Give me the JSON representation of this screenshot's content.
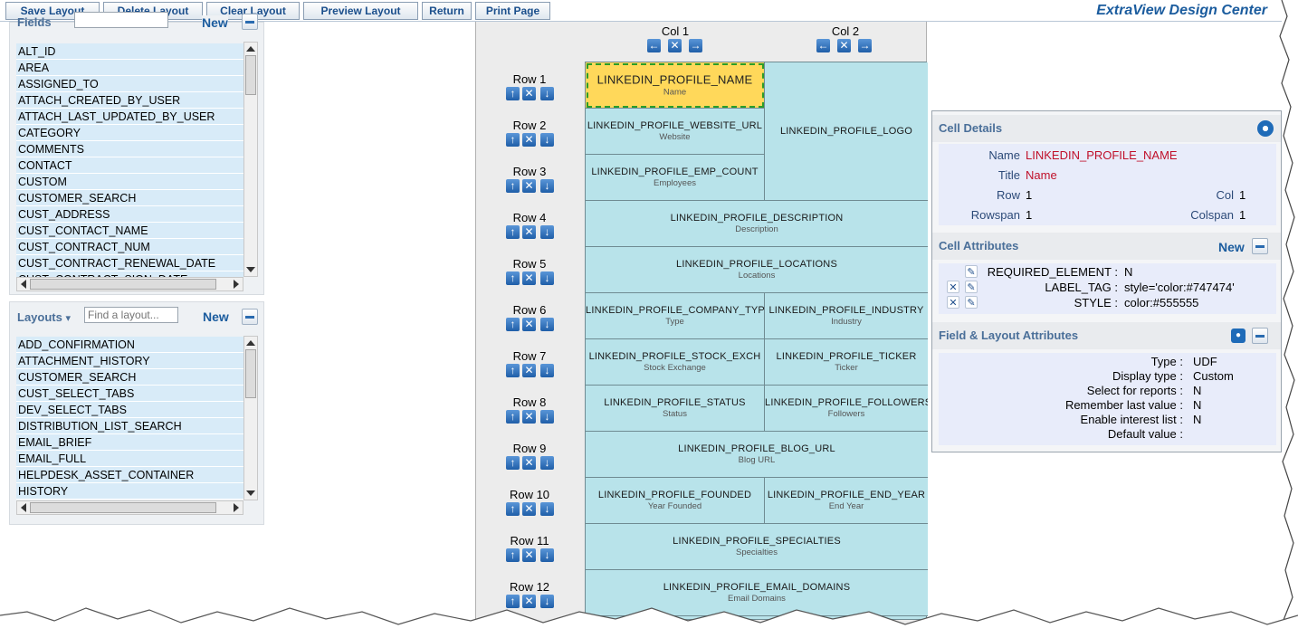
{
  "toolbar": {
    "buttons": [
      "Save Layout",
      "Delete Layout",
      "Clear Layout",
      "Preview Layout",
      "Return",
      "Print Page"
    ],
    "app_title": "ExtraView Design Center"
  },
  "fields_panel": {
    "title": "Fields",
    "search_placeholder": "",
    "new_label": "New",
    "items": [
      "ALT_ID",
      "AREA",
      "ASSIGNED_TO",
      "ATTACH_CREATED_BY_USER",
      "ATTACH_LAST_UPDATED_BY_USER",
      "CATEGORY",
      "COMMENTS",
      "CONTACT",
      "CUSTOM",
      "CUSTOMER_SEARCH",
      "CUST_ADDRESS",
      "CUST_CONTACT_NAME",
      "CUST_CONTRACT_NUM",
      "CUST_CONTRACT_RENEWAL_DATE",
      "CUST_CONTRACT_SIGN_DATE"
    ]
  },
  "layouts_panel": {
    "title": "Layouts",
    "dropdown_arrow": "▾",
    "search_placeholder": "Find a layout...",
    "new_label": "New",
    "items": [
      "ADD_CONFIRMATION",
      "ATTACHMENT_HISTORY",
      "CUSTOMER_SEARCH",
      "CUST_SELECT_TABS",
      "DEV_SELECT_TABS",
      "DISTRIBUTION_LIST_SEARCH",
      "EMAIL_BRIEF",
      "EMAIL_FULL",
      "HELPDESK_ASSET_CONTAINER",
      "HISTORY"
    ]
  },
  "grid": {
    "columns": [
      "Col 1",
      "Col 2"
    ],
    "rows": [
      "Row 1",
      "Row 2",
      "Row 3",
      "Row 4",
      "Row 5",
      "Row 6",
      "Row 7",
      "Row 8",
      "Row 9",
      "Row 10",
      "Row 11",
      "Row 12"
    ],
    "cells": [
      {
        "name": "LINKEDIN_PROFILE_NAME",
        "title": "Name",
        "row": 1,
        "col": 1,
        "rowspan": 1,
        "colspan": 1,
        "selected": true
      },
      {
        "name": "LINKEDIN_PROFILE_LOGO",
        "title": "",
        "row": 1,
        "col": 2,
        "rowspan": 3,
        "colspan": 1
      },
      {
        "name": "LINKEDIN_PROFILE_WEBSITE_URL",
        "title": "Website",
        "row": 2,
        "col": 1,
        "rowspan": 1,
        "colspan": 1
      },
      {
        "name": "LINKEDIN_PROFILE_EMP_COUNT",
        "title": "Employees",
        "row": 3,
        "col": 1,
        "rowspan": 1,
        "colspan": 1
      },
      {
        "name": "LINKEDIN_PROFILE_DESCRIPTION",
        "title": "Description",
        "row": 4,
        "col": 1,
        "rowspan": 1,
        "colspan": 2
      },
      {
        "name": "LINKEDIN_PROFILE_LOCATIONS",
        "title": "Locations",
        "row": 5,
        "col": 1,
        "rowspan": 1,
        "colspan": 2
      },
      {
        "name": "LINKEDIN_PROFILE_COMPANY_TYPE",
        "title": "Type",
        "row": 6,
        "col": 1,
        "rowspan": 1,
        "colspan": 1
      },
      {
        "name": "LINKEDIN_PROFILE_INDUSTRY",
        "title": "Industry",
        "row": 6,
        "col": 2,
        "rowspan": 1,
        "colspan": 1
      },
      {
        "name": "LINKEDIN_PROFILE_STOCK_EXCH",
        "title": "Stock Exchange",
        "row": 7,
        "col": 1,
        "rowspan": 1,
        "colspan": 1
      },
      {
        "name": "LINKEDIN_PROFILE_TICKER",
        "title": "Ticker",
        "row": 7,
        "col": 2,
        "rowspan": 1,
        "colspan": 1
      },
      {
        "name": "LINKEDIN_PROFILE_STATUS",
        "title": "Status",
        "row": 8,
        "col": 1,
        "rowspan": 1,
        "colspan": 1
      },
      {
        "name": "LINKEDIN_PROFILE_FOLLOWERS",
        "title": "Followers",
        "row": 8,
        "col": 2,
        "rowspan": 1,
        "colspan": 1
      },
      {
        "name": "LINKEDIN_PROFILE_BLOG_URL",
        "title": "Blog URL",
        "row": 9,
        "col": 1,
        "rowspan": 1,
        "colspan": 2
      },
      {
        "name": "LINKEDIN_PROFILE_FOUNDED",
        "title": "Year Founded",
        "row": 10,
        "col": 1,
        "rowspan": 1,
        "colspan": 1
      },
      {
        "name": "LINKEDIN_PROFILE_END_YEAR",
        "title": "End Year",
        "row": 10,
        "col": 2,
        "rowspan": 1,
        "colspan": 1
      },
      {
        "name": "LINKEDIN_PROFILE_SPECIALTIES",
        "title": "Specialties",
        "row": 11,
        "col": 1,
        "rowspan": 1,
        "colspan": 2
      },
      {
        "name": "LINKEDIN_PROFILE_EMAIL_DOMAINS",
        "title": "Email Domains",
        "row": 12,
        "col": 1,
        "rowspan": 1,
        "colspan": 2
      }
    ]
  },
  "cell_details": {
    "title": "Cell Details",
    "name_label": "Name",
    "name_value": "LINKEDIN_PROFILE_NAME",
    "title_label": "Title",
    "title_value": "Name",
    "row_label": "Row",
    "row_value": "1",
    "col_label": "Col",
    "col_value": "1",
    "rowspan_label": "Rowspan",
    "rowspan_value": "1",
    "colspan_label": "Colspan",
    "colspan_value": "1"
  },
  "cell_attributes": {
    "title": "Cell Attributes",
    "new_label": "New",
    "items": [
      {
        "key": "REQUIRED_ELEMENT :",
        "value": "N"
      },
      {
        "key": "LABEL_TAG :",
        "value": "style='color:#747474'"
      },
      {
        "key": "STYLE :",
        "value": "color:#555555"
      }
    ]
  },
  "field_layout_attributes": {
    "title": "Field & Layout Attributes",
    "items": [
      {
        "key": "Type :",
        "value": "UDF"
      },
      {
        "key": "Display type :",
        "value": "Custom"
      },
      {
        "key": "Select for reports :",
        "value": "N"
      },
      {
        "key": "Remember last value :",
        "value": "N"
      },
      {
        "key": "Enable interest list :",
        "value": "N"
      },
      {
        "key": "Default value :",
        "value": ""
      }
    ]
  },
  "colors": {
    "accent": "#1b5c9e",
    "cell_bg": "#b8e3ea",
    "selected_cell_bg": "#ffd85a",
    "detail_value": "#c0102a"
  },
  "icons": {
    "move_left": "←",
    "move_right": "→",
    "move_up": "↑",
    "move_down": "↓",
    "delete": "✕",
    "edit": "✎"
  }
}
